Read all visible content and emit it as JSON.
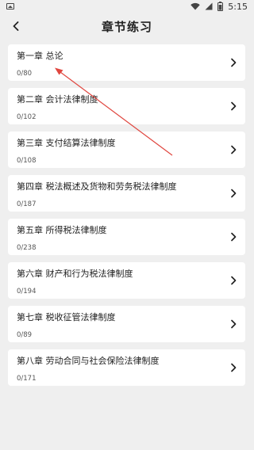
{
  "status_bar": {
    "time": "5:15",
    "icons": [
      "image-icon",
      "wifi-icon",
      "signal-icon",
      "battery-icon"
    ]
  },
  "header": {
    "title": "章节练习",
    "back_icon": "chevron-left-icon"
  },
  "chapters": [
    {
      "title": "第一章 总论",
      "count": "0/80"
    },
    {
      "title": "第二章 会计法律制度",
      "count": "0/102"
    },
    {
      "title": "第三章 支付结算法律制度",
      "count": "0/108"
    },
    {
      "title": "第四章 税法概述及货物和劳务税法律制度",
      "count": "0/187"
    },
    {
      "title": "第五章 所得税法律制度",
      "count": "0/238"
    },
    {
      "title": "第六章 财产和行为税法律制度",
      "count": "0/194"
    },
    {
      "title": "第七章 税收征管法律制度",
      "count": "0/89"
    },
    {
      "title": "第八章 劳动合同与社会保险法律制度",
      "count": "0/171"
    }
  ],
  "colors": {
    "background": "#efefef",
    "card": "#ffffff",
    "annotation_arrow": "#e0463f"
  }
}
